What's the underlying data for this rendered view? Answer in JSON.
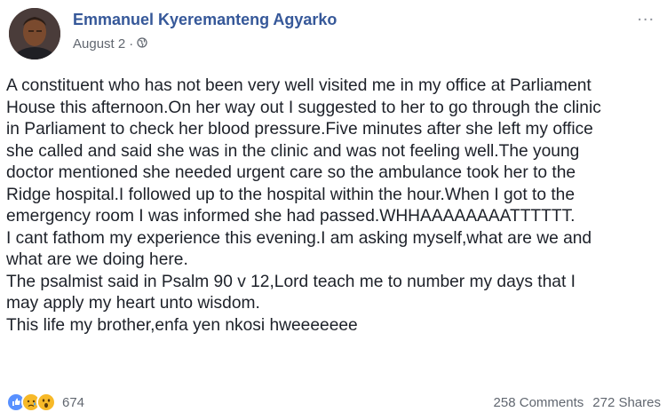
{
  "post": {
    "author": "Emmanuel Kyeremanteng Agyarko",
    "date": "August 2",
    "date_separator": "·",
    "audience_icon": "globe-icon",
    "more_icon": "more-options-icon",
    "more_label": "...",
    "body_lines": [
      "A constituent who has not been very well visited me in my office at Parliament",
      "House this afternoon.On her way out I suggested to her to go through the clinic",
      "in Parliament to check her blood pressure.Five minutes after she left my office",
      "she called and said she was in the clinic and was not feeling well.The young",
      "doctor mentioned she needed urgent care so the ambulance took her to the",
      "Ridge hospital.I followed up to the hospital within the hour.When I got to the",
      "emergency room I was informed she had passed.WHHAAAAAAAATTTTTT.",
      "I cant fathom my experience this evening.I am asking myself,what are we and",
      "what are we doing here.",
      "The psalmist said in Psalm 90 v 12,Lord teach me to number my days that I",
      "may apply my heart unto wisdom.",
      "This life my brother,enfa yen nkosi hweeeeeee"
    ]
  },
  "footer": {
    "reaction_icons": [
      "like-icon",
      "sad-icon",
      "wow-icon"
    ],
    "reaction_count": "674",
    "comments": "258 Comments",
    "shares": "272 Shares"
  },
  "colors": {
    "author_link": "#365899",
    "meta_text": "#616770",
    "body_text": "#1d2129",
    "like_blue": "#5890ff",
    "reaction_yellow": "#f7b928"
  }
}
